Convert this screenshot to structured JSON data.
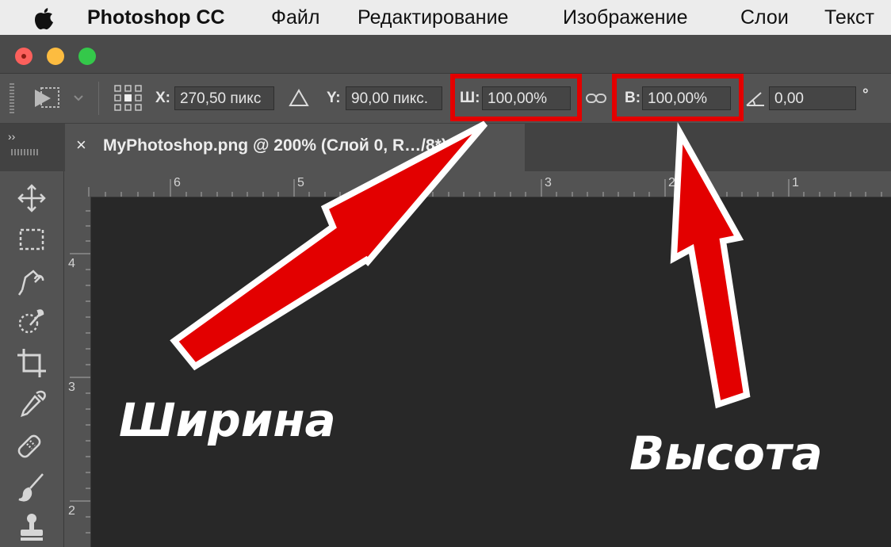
{
  "menubar": {
    "apple_icon": "apple-logo",
    "app_name": "Photoshop CC",
    "items": [
      "Файл",
      "Редактирование",
      "Изображение",
      "Слои",
      "Текст"
    ]
  },
  "options": {
    "x_label": "X:",
    "x_value": "270,50 пикс",
    "y_label": "Y:",
    "y_value": "90,00 пикс.",
    "w_label": "Ш:",
    "w_value": "100,00%",
    "h_label": "В:",
    "h_value": "100,00%",
    "angle_value": "0,00",
    "degree_symbol": "°"
  },
  "document": {
    "tab_close": "×",
    "tab_title": "MyPhotoshop.png @ 200% (Слой 0, R…/8*) *"
  },
  "panel": {
    "collapse_label": "››"
  },
  "rulers": {
    "horizontal": [
      "6",
      "5",
      "3",
      "2",
      "1"
    ],
    "vertical": [
      "4",
      "3",
      "2"
    ]
  },
  "annotations": {
    "width_label": "Ширина",
    "height_label": "Высота"
  },
  "colors": {
    "highlight": "#e30000",
    "arrow_fill": "#e30000",
    "arrow_outline": "#ffffff",
    "canvas": "#282828",
    "ui_gray": "#535353"
  },
  "tools": [
    "move-icon",
    "marquee-icon",
    "lasso-icon",
    "quick-selection-icon",
    "crop-icon",
    "eyedropper-icon",
    "healing-brush-icon",
    "brush-icon",
    "stamp-icon"
  ]
}
